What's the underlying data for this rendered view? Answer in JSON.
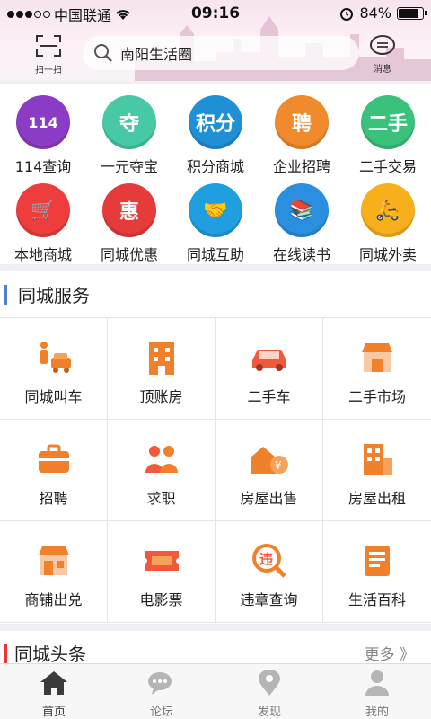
{
  "status": {
    "carrier": "中国联通",
    "time": "09:16",
    "battery": "84%",
    "battery_level": 0.84
  },
  "header": {
    "scan_label": "扫一扫",
    "search_text": "南阳生活圈",
    "message_label": "消息"
  },
  "apps": [
    {
      "label": "114查询",
      "glyph": "114",
      "color": "#8b3cc4",
      "icon": "phonebook-icon"
    },
    {
      "label": "一元夺宝",
      "glyph": "夺",
      "color": "#46c9a4",
      "icon": "treasure-icon"
    },
    {
      "label": "积分商城",
      "glyph": "积分",
      "color": "#1f8fd6",
      "icon": "points-icon"
    },
    {
      "label": "企业招聘",
      "glyph": "聘",
      "color": "#f08a2c",
      "icon": "recruit-icon"
    },
    {
      "label": "二手交易",
      "glyph": "二手",
      "color": "#3ac27d",
      "icon": "secondhand-icon"
    },
    {
      "label": "本地商城",
      "glyph": "🛒",
      "color": "#ef3d3d",
      "icon": "cart-icon"
    },
    {
      "label": "同城优惠",
      "glyph": "惠",
      "color": "#e63b3b",
      "icon": "discount-icon"
    },
    {
      "label": "同城互助",
      "glyph": "🤝",
      "color": "#1f9fe0",
      "icon": "handshake-icon"
    },
    {
      "label": "在线读书",
      "glyph": "📚",
      "color": "#2b8fe0",
      "icon": "books-icon"
    },
    {
      "label": "同城外卖",
      "glyph": "🛵",
      "color": "#f7b01c",
      "icon": "scooter-icon"
    }
  ],
  "services": {
    "title": "同城服务",
    "items": [
      {
        "label": "同城叫车",
        "icon": "taxi-icon"
      },
      {
        "label": "顶账房",
        "icon": "building-icon"
      },
      {
        "label": "二手车",
        "icon": "car-icon"
      },
      {
        "label": "二手市场",
        "icon": "market-icon"
      },
      {
        "label": "招聘",
        "icon": "briefcase-icon"
      },
      {
        "label": "求职",
        "icon": "people-icon"
      },
      {
        "label": "房屋出售",
        "icon": "house-sale-icon"
      },
      {
        "label": "房屋出租",
        "icon": "house-rent-icon"
      },
      {
        "label": "商铺出兑",
        "icon": "shop-icon"
      },
      {
        "label": "电影票",
        "icon": "ticket-icon"
      },
      {
        "label": "违章查询",
        "icon": "violation-icon"
      },
      {
        "label": "生活百科",
        "icon": "encyclopedia-icon"
      }
    ]
  },
  "headlines": {
    "title": "同城头条",
    "more": "更多 》"
  },
  "tabs": [
    {
      "label": "首页",
      "icon": "home-icon",
      "active": true
    },
    {
      "label": "论坛",
      "icon": "forum-icon",
      "active": false
    },
    {
      "label": "发现",
      "icon": "location-icon",
      "active": false
    },
    {
      "label": "我的",
      "icon": "user-icon",
      "active": false
    }
  ]
}
